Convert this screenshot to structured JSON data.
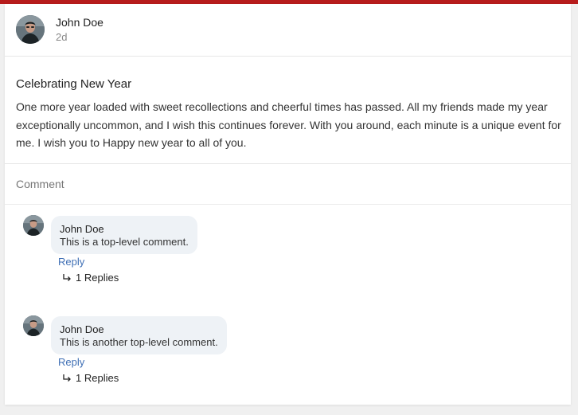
{
  "post": {
    "author": "John Doe",
    "time": "2d",
    "title": "Celebrating New Year",
    "body": "One more year loaded with sweet recollections and cheerful times has passed. All my friends made my year exceptionally uncommon, and I wish this continues forever. With you around, each minute is a unique event for me. I wish you to Happy new year to all of you."
  },
  "comment_box": {
    "placeholder": "Comment"
  },
  "comments": [
    {
      "author": "John Doe",
      "text": "This is a top-level comment.",
      "reply_label": "Reply",
      "replies_label": "1 Replies"
    },
    {
      "author": "John Doe",
      "text": "This is another top-level comment.",
      "reply_label": "Reply",
      "replies_label": "1 Replies"
    }
  ],
  "colors": {
    "accent_bar": "#b71c1c",
    "link": "#3f6fb5",
    "bubble": "#eef2f6"
  },
  "icons": {
    "avatar": "user-photo",
    "reply_arrow": "subdirectory-arrow-right-icon"
  }
}
